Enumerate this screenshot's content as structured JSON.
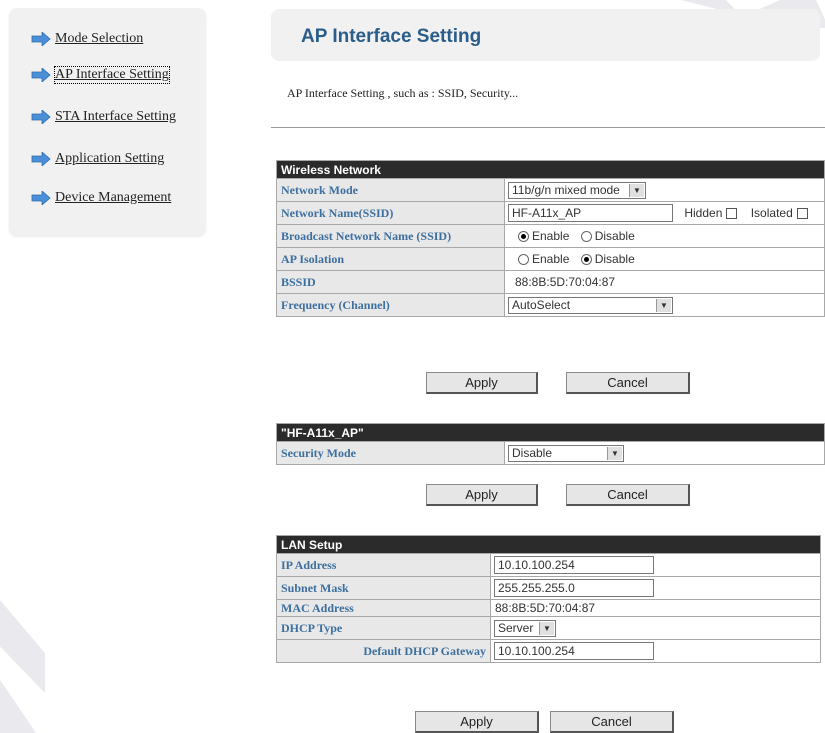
{
  "sidebar": {
    "items": [
      {
        "label": "Mode Selection"
      },
      {
        "label": "AP Interface Setting"
      },
      {
        "label": "STA Interface Setting"
      },
      {
        "label": "Application Setting"
      },
      {
        "label": "Device Management"
      }
    ]
  },
  "header": {
    "title": "AP Interface Setting",
    "description": "AP Interface Setting , such as : SSID, Security..."
  },
  "wireless": {
    "title": "Wireless Network",
    "network_mode": {
      "label": "Network Mode",
      "value": "11b/g/n mixed mode"
    },
    "ssid": {
      "label": "Network Name(SSID)",
      "value": "HF-A11x_AP",
      "hidden_label": "Hidden",
      "isolated_label": "Isolated"
    },
    "broadcast": {
      "label": "Broadcast Network Name (SSID)",
      "enable": "Enable",
      "disable": "Disable",
      "selected": "Enable"
    },
    "isolation": {
      "label": "AP Isolation",
      "enable": "Enable",
      "disable": "Disable",
      "selected": "Disable"
    },
    "bssid": {
      "label": "BSSID",
      "value": "88:8B:5D:70:04:87"
    },
    "frequency": {
      "label": "Frequency (Channel)",
      "value": "AutoSelect"
    },
    "apply": "Apply",
    "cancel": "Cancel"
  },
  "security": {
    "title": "\"HF-A11x_AP\"",
    "mode": {
      "label": "Security Mode",
      "value": "Disable"
    },
    "apply": "Apply",
    "cancel": "Cancel"
  },
  "lan": {
    "title": "LAN Setup",
    "ip": {
      "label": "IP Address",
      "value": "10.10.100.254"
    },
    "mask": {
      "label": "Subnet Mask",
      "value": "255.255.255.0"
    },
    "mac": {
      "label": "MAC Address",
      "value": "88:8B:5D:70:04:87"
    },
    "dhcp": {
      "label": "DHCP Type",
      "value": "Server"
    },
    "gateway": {
      "label": "Default DHCP Gateway",
      "value": "10.10.100.254"
    },
    "apply": "Apply",
    "cancel": "Cancel"
  },
  "colors": {
    "title_blue": "#2a5d8a",
    "label_blue": "#3d6f9f",
    "section_header": "#2b2b2b",
    "nav_arrow": "#4a8fd8"
  }
}
